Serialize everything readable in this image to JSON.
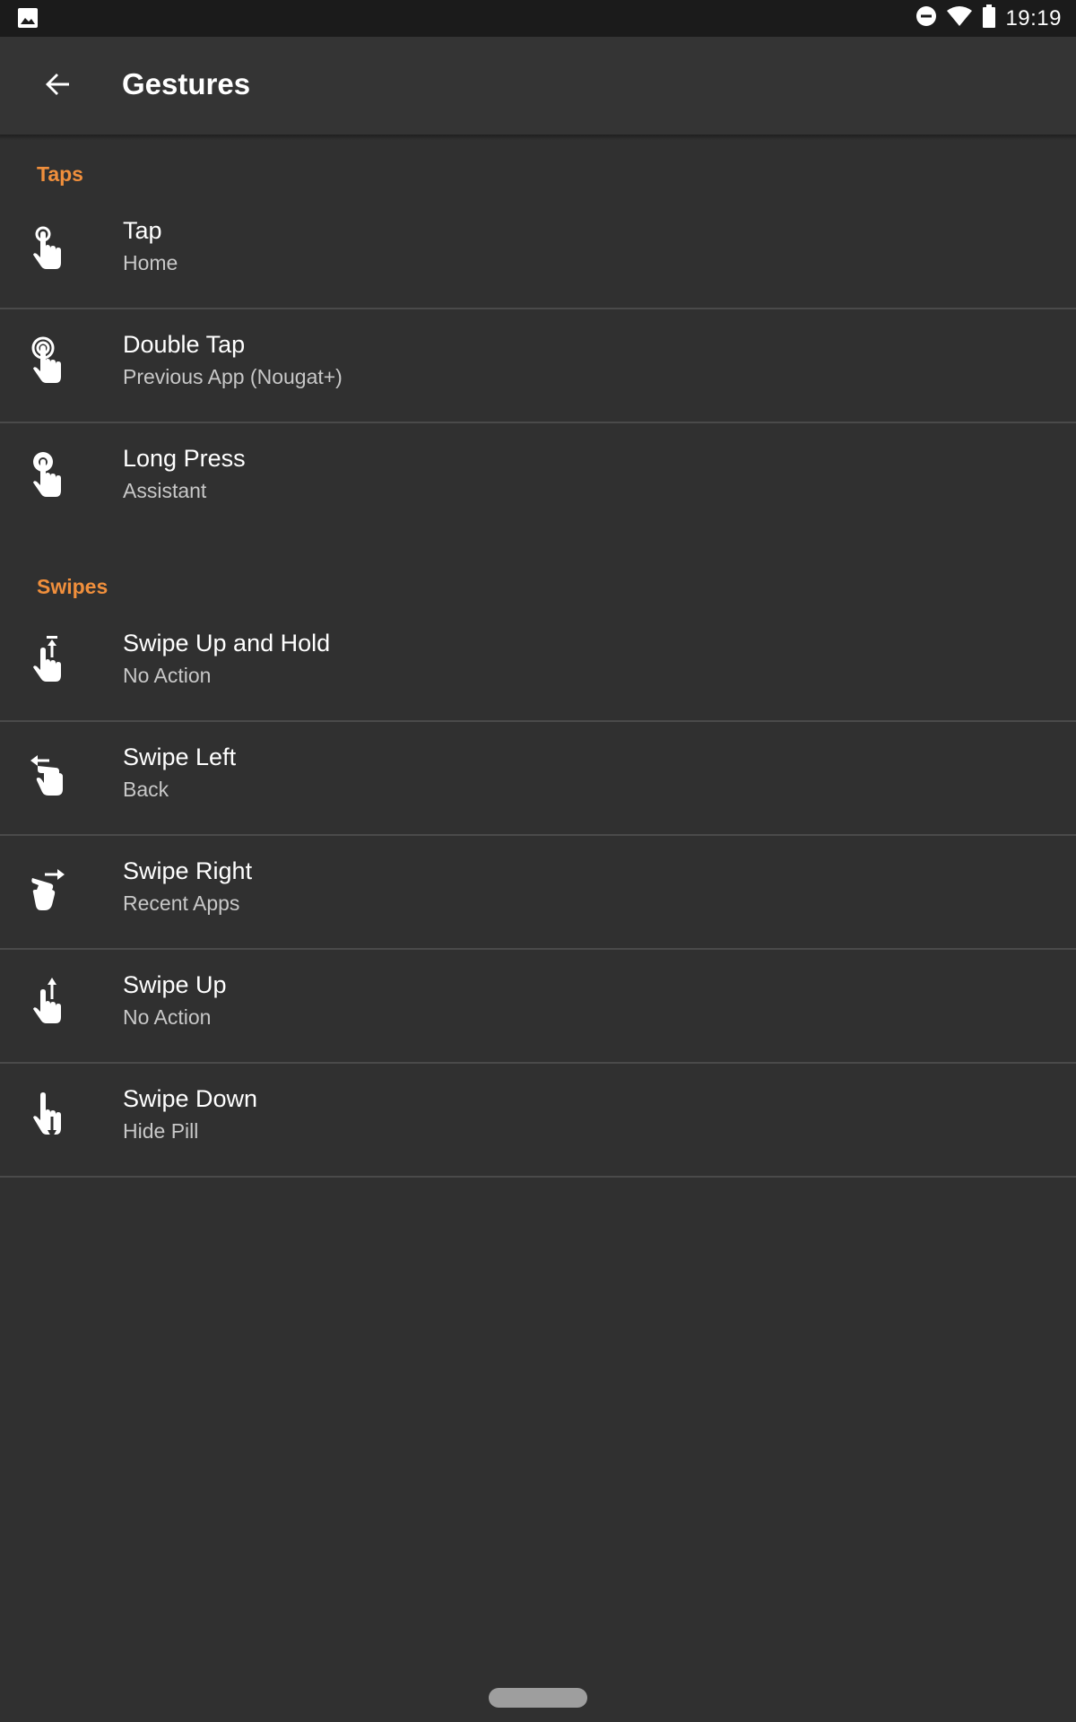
{
  "status_bar": {
    "time": "19:19",
    "icons": [
      "image-icon",
      "do-not-disturb-icon",
      "wifi-icon",
      "battery-icon"
    ]
  },
  "app_bar": {
    "title": "Gestures",
    "back_icon": "arrow-back-icon"
  },
  "sections": {
    "taps": {
      "header": "Taps",
      "items": [
        {
          "title": "Tap",
          "value": "Home",
          "icon": "tap-gesture-icon"
        },
        {
          "title": "Double Tap",
          "value": "Previous App (Nougat+)",
          "icon": "double-tap-gesture-icon"
        },
        {
          "title": "Long Press",
          "value": "Assistant",
          "icon": "long-press-gesture-icon"
        }
      ]
    },
    "swipes": {
      "header": "Swipes",
      "items": [
        {
          "title": "Swipe Up and Hold",
          "value": "No Action",
          "icon": "swipe-up-hold-gesture-icon"
        },
        {
          "title": "Swipe Left",
          "value": "Back",
          "icon": "swipe-left-gesture-icon"
        },
        {
          "title": "Swipe Right",
          "value": "Recent Apps",
          "icon": "swipe-right-gesture-icon"
        },
        {
          "title": "Swipe Up",
          "value": "No Action",
          "icon": "swipe-up-gesture-icon"
        },
        {
          "title": "Swipe Down",
          "value": "Hide Pill",
          "icon": "swipe-down-gesture-icon"
        }
      ]
    }
  },
  "colors": {
    "background": "#303030",
    "app_bar": "#343434",
    "status_bar": "#1b1b1b",
    "accent": "#f08f3c",
    "divider": "#4a4a4a",
    "primary_text": "#ffffff",
    "secondary_text": "#c8c8c8"
  }
}
